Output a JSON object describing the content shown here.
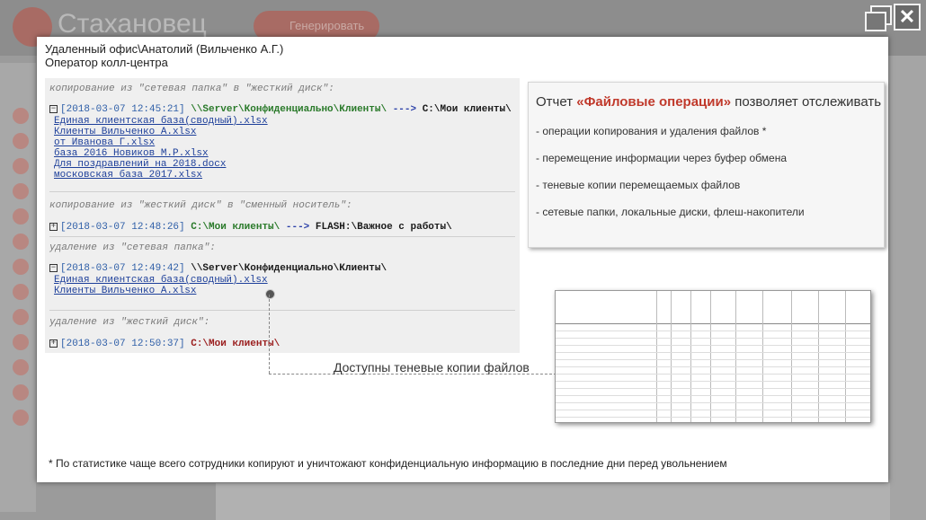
{
  "background": {
    "app_title": "Стахановец",
    "generate_button": "Генерировать"
  },
  "window": {
    "restore_icon": "restore-icon",
    "close_label": "✕"
  },
  "header": {
    "line1": "Удаленный офис\\Анатолий (Вильченко А.Г.)",
    "line2": "Оператор колл-центра"
  },
  "log": {
    "s1_title": "копирование из \"сетевая папка\" в \"жесткий диск\":",
    "s1_ts": "[2018-03-07 12:45:21]",
    "s1_src": "\\\\Server\\Конфиденциально\\Клиенты\\",
    "s1_arrow": "--->",
    "s1_dst": "C:\\Мои клиенты\\",
    "s1_files": [
      "Единая клиентская база(сводный).xlsx",
      "Клиенты Вильченко А.xlsx",
      "от Иванова Г.xlsx",
      "база 2016 Новиков М.Р.xlsx",
      "Для поздравлений на 2018.docx",
      "московская база 2017.xlsx"
    ],
    "s2_title": "копирование из \"жесткий диск\" в \"сменный носитель\":",
    "s2_ts": "[2018-03-07 12:48:26]",
    "s2_src": "C:\\Мои клиенты\\",
    "s2_arrow": "--->",
    "s2_dst": "FLASH:\\Важное с работы\\",
    "s3_title": "удаление из \"сетевая папка\":",
    "s3_ts": "[2018-03-07 12:49:42]",
    "s3_src": "\\\\Server\\Конфиденциально\\Клиенты\\",
    "s3_files": [
      "Единая клиентская база(сводный).xlsx",
      "Клиенты Вильченко А.xlsx"
    ],
    "s4_title": "удаление из \"жесткий диск\":",
    "s4_ts": "[2018-03-07 12:50:37]",
    "s4_src": "C:\\Мои клиенты\\"
  },
  "info": {
    "title_pre": "Отчет ",
    "title_bold": "«Файловые операции»",
    "title_post": " позволяет отслеживать",
    "items": [
      "- операции копирования и удаления файлов *",
      "- перемещение информации через буфер обмена",
      "- теневые копии перемещаемых файлов",
      "- сетевые папки, локальные диски, флеш-накопители"
    ]
  },
  "callout": "Доступны теневые копии файлов",
  "footnote": "* По статистике чаще всего сотрудники копируют и уничтожают конфиденциальную информацию в последние дни перед увольнением"
}
